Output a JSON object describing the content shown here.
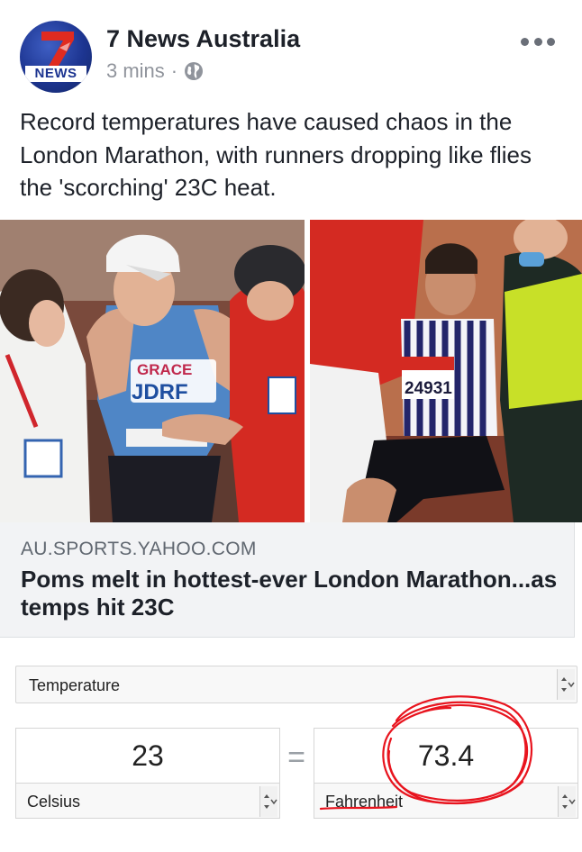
{
  "post": {
    "page_name": "7 News Australia",
    "avatar_text": "NEWS",
    "time": "3 mins",
    "separator": "·",
    "privacy_icon": "globe-icon",
    "more_icon": "more-horizontal-icon",
    "text": "Record temperatures have caused chaos in the London Marathon, with runners dropping like flies the 'scorching' 23C heat."
  },
  "link": {
    "domain": "AU.SPORTS.YAHOO.COM",
    "title": "Poms melt in hottest-ever London Marathon...as temps hit 23C"
  },
  "converter": {
    "unit_type": "Temperature",
    "from_value": "23",
    "from_unit": "Celsius",
    "equals": "=",
    "to_value": "73.4",
    "to_unit": "Fahrenheit"
  },
  "photo": {
    "left_bib_name": "GRACE",
    "left_bib_charity": "JDRF",
    "right_bib_number": "24931"
  },
  "colors": {
    "brand": "#1d3591",
    "brand_red": "#e02b20",
    "annotation_red": "#e8141e",
    "text": "#1d2129",
    "muted": "#90949c"
  }
}
